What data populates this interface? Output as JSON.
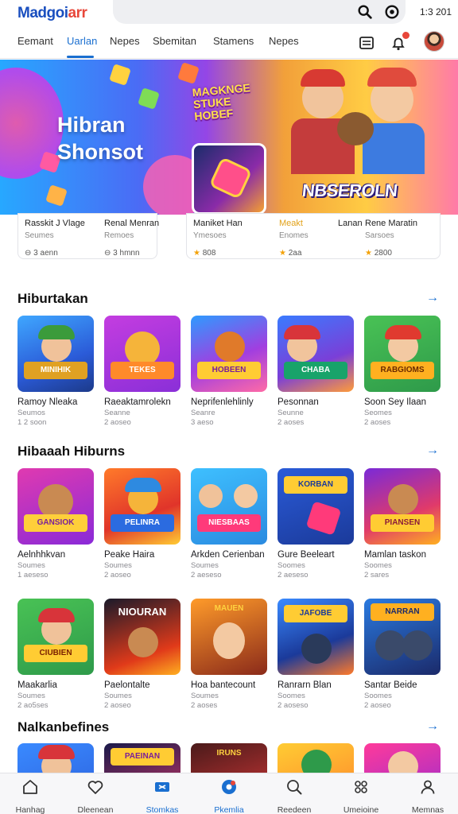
{
  "app": {
    "logo": "Madgoiarr",
    "clock": "1:3 201"
  },
  "search": {
    "placeholder": ""
  },
  "tabs": [
    {
      "label": "Eemant",
      "active": false
    },
    {
      "label": "Uarlan",
      "active": true
    },
    {
      "label": "Nepes",
      "active": false
    },
    {
      "label": "Sbemitan",
      "active": false
    },
    {
      "label": "Stamens",
      "active": false
    },
    {
      "label": "Nepes",
      "active": false
    }
  ],
  "toolbar_icons": [
    "list-icon",
    "bell-icon",
    "avatar"
  ],
  "hero": {
    "title_line1": "Hibran",
    "title_line2": "Shonsot",
    "logo_text": "MAGKNGE STUKE HOBEF",
    "banner_text": "NBSEROLN"
  },
  "featured": [
    {
      "name": "Rasskit J Vlage",
      "sub": "Seumes",
      "meta": "3 aenn"
    },
    {
      "name": "Renal Menran",
      "sub": "Remoes",
      "meta": "3 hmnn"
    },
    {
      "name": "Maniket Han",
      "sub": "Ymesoes",
      "meta": "808"
    },
    {
      "name": "Meakt",
      "sub": "Enomes",
      "meta": "2aa"
    },
    {
      "name": "Lanan",
      "sub": "",
      "meta": ""
    },
    {
      "name": "Rene Maratin",
      "sub": "Sarsoes",
      "meta": "2800"
    }
  ],
  "sections": [
    {
      "title": "Hiburtakan",
      "apps": [
        {
          "name": "Ramoy Nleaka",
          "cat": "Seumos",
          "size": "1 2 soon",
          "plate": "MINIHIK"
        },
        {
          "name": "Raeaktamrolekn",
          "cat": "Seanne",
          "size": "2 aoseo",
          "plate": "TEKES"
        },
        {
          "name": "Neprifenlehlinly",
          "cat": "Seanre",
          "size": "3 aeso",
          "plate": "HOBEEN"
        },
        {
          "name": "Pesonnan",
          "cat": "Seunne",
          "size": "2 aoses",
          "plate": "CHABA"
        },
        {
          "name": "Soon Sey Ilaan",
          "cat": "Seomes",
          "size": "2 aoses",
          "plate": "RABGIOMS"
        }
      ]
    },
    {
      "title": "Hibaaah Hiburns",
      "apps": [
        {
          "name": "Aelnhhkvan",
          "cat": "Soumes",
          "size": "1 aeseso",
          "plate": "GANSIOK"
        },
        {
          "name": "Peake Haira",
          "cat": "Soumes",
          "size": "2 aoseo",
          "plate": "PELINRA"
        },
        {
          "name": "Arkden Cerienban",
          "cat": "Soumes",
          "size": "2 aeseso",
          "plate": "NIESBAAS"
        },
        {
          "name": "Gure Beeleart",
          "cat": "Soomes",
          "size": "2 aeseso",
          "plate": "KORBAN"
        },
        {
          "name": "Mamlan taskon",
          "cat": "Soomes",
          "size": "2 sares",
          "plate": "PIANSEN"
        }
      ]
    },
    {
      "title": "",
      "apps": [
        {
          "name": "Maakarlia",
          "cat": "Soumes",
          "size": "2 ao5ses",
          "plate": "CIUBIEN"
        },
        {
          "name": "Paelontalte",
          "cat": "Soumes",
          "size": "2 aoseo",
          "plate": "NIOURAN"
        },
        {
          "name": "Hoa bantecount",
          "cat": "Soumes",
          "size": "2 aoses",
          "plate": "MAUEN"
        },
        {
          "name": "Ranrarn Blan",
          "cat": "Soomes",
          "size": "2 aoseso",
          "plate": "JAFOBE"
        },
        {
          "name": "Santar Beide",
          "cat": "Soomes",
          "size": "2 aoseo",
          "plate": "NARRAN"
        }
      ]
    },
    {
      "title": "Nalkanbefines",
      "apps": [
        {
          "plate": ""
        },
        {
          "plate": "PAEINAN"
        },
        {
          "plate": "IRUNS"
        },
        {
          "plate": ""
        },
        {
          "plate": ""
        }
      ]
    }
  ],
  "bottom_nav": [
    {
      "label": "Hanhag",
      "icon": "home-icon",
      "active": false
    },
    {
      "label": "Dleenean",
      "icon": "heart-icon",
      "active": false
    },
    {
      "label": "Stomkas",
      "icon": "ticket-icon",
      "active": true
    },
    {
      "label": "Pkemlia",
      "icon": "circle-icon",
      "active": true
    },
    {
      "label": "Reedeen",
      "icon": "search-icon",
      "active": false
    },
    {
      "label": "Umeioine",
      "icon": "apps-icon",
      "active": false
    },
    {
      "label": "Memnas",
      "icon": "person-icon",
      "active": false
    }
  ],
  "colors": {
    "accent": "#1a6fd0",
    "badge": "#e8473a"
  }
}
